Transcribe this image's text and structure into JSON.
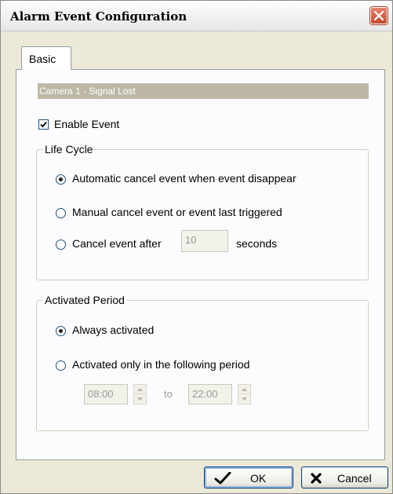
{
  "window": {
    "title": "Alarm Event Configuration",
    "close_icon": "close-icon"
  },
  "tabs": [
    {
      "label": "Basic",
      "selected": true
    }
  ],
  "header": {
    "text": "Camera 1 - Signal Lost"
  },
  "enable_event": {
    "label": "Enable Event",
    "checked": true
  },
  "life_cycle": {
    "legend": "Life Cycle",
    "options": [
      {
        "label": "Automatic cancel event when event disappear",
        "selected": true
      },
      {
        "label": "Manual cancel event or event last triggered",
        "selected": false
      },
      {
        "label": "Cancel event after",
        "selected": false
      }
    ],
    "cancel_after_value": "10",
    "cancel_after_unit": "seconds"
  },
  "activated_period": {
    "legend": "Activated Period",
    "options": [
      {
        "label": "Always activated",
        "selected": true
      },
      {
        "label": "Activated only in the following period",
        "selected": false
      }
    ],
    "start_time": "08:00",
    "to_label": "to",
    "end_time": "22:00"
  },
  "buttons": {
    "ok": "OK",
    "cancel": "Cancel"
  },
  "colors": {
    "header_bar": "#bdb8a6",
    "dialog_bg": "#ece9d8",
    "panel_bg": "#fcfcfe",
    "ok_check": "#000000",
    "cancel_x": "#000000"
  }
}
